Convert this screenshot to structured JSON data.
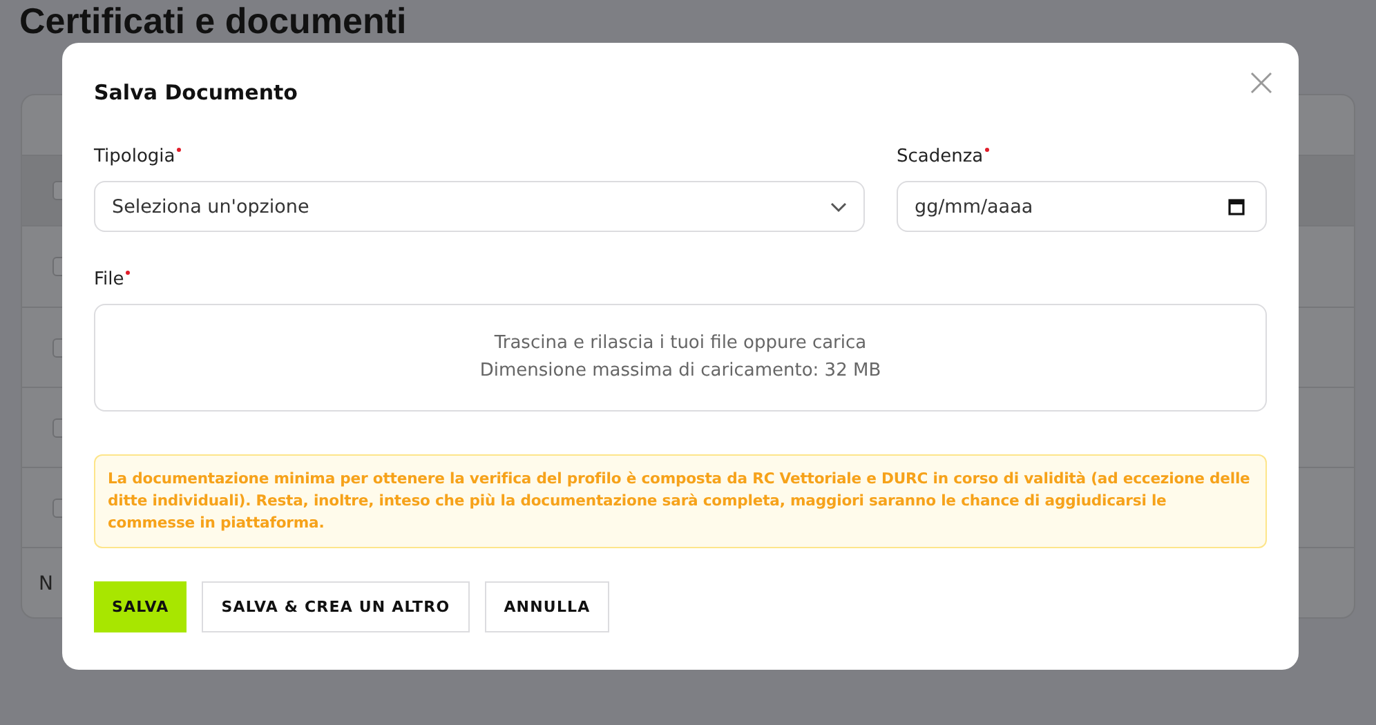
{
  "page": {
    "title": "Certificati e documenti",
    "table": {
      "rows": [
        {
          "checked": false
        },
        {
          "checked": false
        },
        {
          "checked": false
        },
        {
          "checked": false
        },
        {
          "checked": false
        }
      ],
      "footer": "N"
    }
  },
  "dialog": {
    "title": "Salva Documento",
    "tipologia": {
      "label": "Tipologia",
      "required": true,
      "placeholder": "Seleziona un'opzione"
    },
    "scadenza": {
      "label": "Scadenza",
      "required": true,
      "placeholder": "gg/mm/aaaa"
    },
    "file": {
      "label": "File",
      "required": true,
      "lines": [
        "Trascina e rilascia i tuoi file oppure carica",
        "Dimensione massima di caricamento: 32 MB"
      ]
    },
    "notice": "La documentazione minima per ottenere la verifica del profilo è composta da RC Vettoriale e DURC in corso di validità (ad eccezione delle ditte individuali). Resta, inoltre, inteso che più la documentazione sarà completa, maggiori saranno le chance di aggiudicarsi le commesse in piattaforma.",
    "buttons": [
      {
        "label": "SALVA",
        "kind": "primary"
      },
      {
        "label": "SALVA & CREA UN ALTRO",
        "kind": "secondary"
      },
      {
        "label": "ANNULLA",
        "kind": "secondary"
      }
    ]
  }
}
